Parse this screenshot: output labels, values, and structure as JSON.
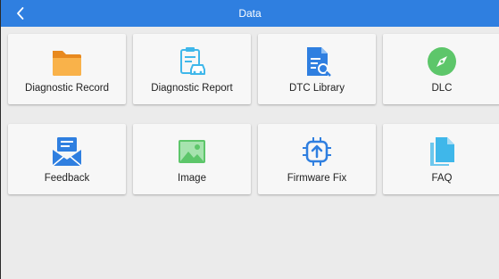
{
  "header": {
    "title": "Data",
    "back_icon": "chevron-left-icon"
  },
  "colors": {
    "header_bg": "#2f7fe0",
    "icon_blue": "#2f7fe0",
    "folder": "#f7a63a",
    "green": "#5dc66a",
    "light_blue": "#3fb7ea"
  },
  "tiles": [
    {
      "label": "Diagnostic Record",
      "icon": "folder-icon"
    },
    {
      "label": "Diagnostic Report",
      "icon": "clipboard-car-icon"
    },
    {
      "label": "DTC Library",
      "icon": "document-search-icon"
    },
    {
      "label": "DLC",
      "icon": "compass-icon"
    },
    {
      "label": "Feedback",
      "icon": "envelope-icon"
    },
    {
      "label": "Image",
      "icon": "image-icon"
    },
    {
      "label": "Firmware Fix",
      "icon": "chip-upload-icon"
    },
    {
      "label": "FAQ",
      "icon": "documents-icon"
    }
  ]
}
